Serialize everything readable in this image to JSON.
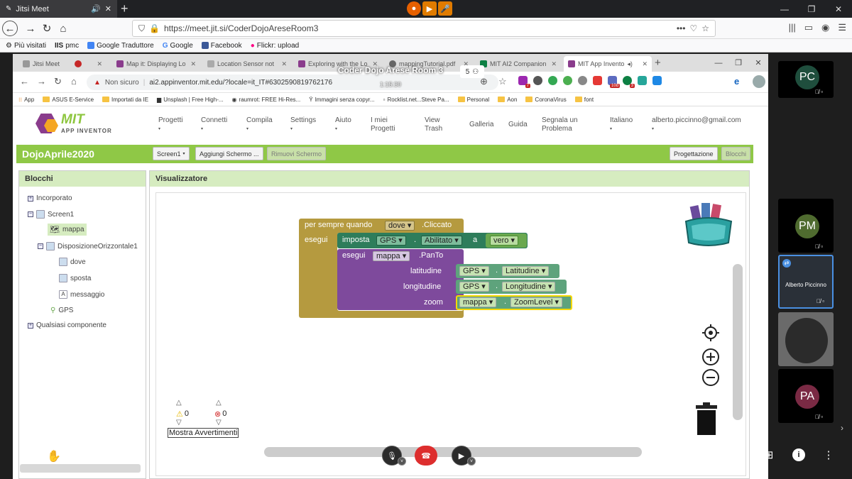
{
  "outer_browser": {
    "tab_title": "Jitsi Meet",
    "url": "https://meet.jit.si/CoderDojoAreseRoom3",
    "bookmarks": [
      "Più visitati",
      "pmc",
      "Google Traduttore",
      "Google",
      "Facebook",
      "Flickr: upload"
    ]
  },
  "meeting": {
    "room_title": "Coder Dojo Arese Room 3",
    "timer": "1:15:30",
    "participant_count": "5"
  },
  "inner_browser": {
    "tabs": [
      "Jitsi Meet",
      "Map it: Displaying Lo",
      "Location Sensor not",
      "Exploring with the Lo",
      "mappingTutorial.pdf",
      "MIT AI2 Companion",
      "MIT App Invento"
    ],
    "url": "ai2.appinventor.mit.edu/?locale=it_IT#6302590819762176",
    "security_label": "Non sicuro",
    "extension_badges": [
      "7",
      "10d",
      "3"
    ],
    "bookmarks": [
      "App",
      "ASUS E-Service",
      "Importati da IE",
      "Unsplash | Free High-...",
      "raumrot: FREE Hi-Res...",
      "Immagini senza copyr...",
      "Rocklist.net...Steve Pa...",
      "Personal",
      "Aon",
      "CoronaVirus",
      "font"
    ]
  },
  "ai": {
    "logo_top": "MIT",
    "logo_bottom": "APP INVENTOR",
    "menu": [
      "Progetti",
      "Connetti",
      "Compila",
      "Settings",
      "Aiuto",
      "I miei\nProgetti",
      "View\nTrash",
      "Galleria",
      "Guida",
      "Segnala un\nProblema",
      "Italiano",
      "alberto.piccinno@gmail.com"
    ],
    "project_name": "DojoAprile2020",
    "screen_select": "Screen1",
    "add_screen": "Aggiungi Schermo ...",
    "remove_screen": "Rimuovi Schermo",
    "designer": "Progettazione",
    "blocks": "Blocchi",
    "blocks_panel_title": "Blocchi",
    "viewer_title": "Visualizzatore",
    "tree": [
      "Incorporato",
      "Screen1",
      "mappa",
      "DisposizioneOrizzontale1",
      "dove",
      "sposta",
      "messaggio",
      "GPS",
      "Qualsiasi componente"
    ],
    "code": {
      "event_prefix": "per sempre quando",
      "event_component": "dove",
      "event_name": ".Cliccato",
      "do1": "esegui",
      "set_word": "imposta",
      "set_component": "GPS",
      "dot": ".",
      "set_property": "Abilitato",
      "to_word": "a",
      "true_value": "vero",
      "do2": "esegui",
      "call_component": "mappa",
      "call_method": ".PanTo",
      "arg1": "latitudine",
      "arg2": "longitudine",
      "arg3": "zoom",
      "lat_component": "GPS",
      "lat_property": "Latitudine",
      "lon_component": "GPS",
      "lon_property": "Longitudine",
      "zoom_component": "mappa",
      "zoom_property": "ZoomLevel"
    },
    "warnings_count": "0",
    "errors_count": "0",
    "show_warnings": "Mostra Avvertimenti"
  },
  "participants": [
    {
      "initials": "PC",
      "color": "#1f4e3d"
    },
    {
      "initials": "PM",
      "color": "#4f6b2f"
    },
    {
      "label": "Alberto Piccinno"
    },
    {
      "initials": "PA",
      "color": "#7a2a44"
    }
  ]
}
